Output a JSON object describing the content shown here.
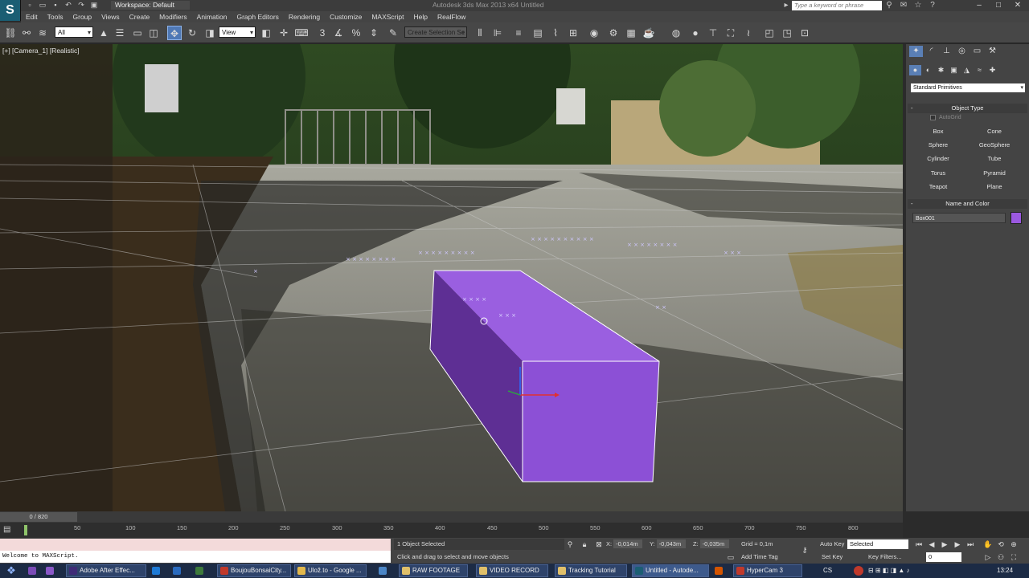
{
  "title_bar": {
    "logo": "S",
    "workspace": "Workspace: Default",
    "app_title": "Autodesk 3ds Max 2013 x64    Untitled",
    "search_placeholder": "Type a keyword or phrase"
  },
  "menu": [
    "Edit",
    "Tools",
    "Group",
    "Views",
    "Create",
    "Modifiers",
    "Animation",
    "Graph Editors",
    "Rendering",
    "Customize",
    "MAXScript",
    "Help",
    "RealFlow"
  ],
  "toolbar": {
    "selection_filter": "All",
    "ref_coord": "View",
    "named_selection": "Create Selection Se"
  },
  "viewport": {
    "label": "[+] [Camera_1] [Realistic]",
    "object_color": "#9b59e0"
  },
  "command_panel": {
    "primitive_type": "Standard Primitives",
    "object_type_header": "Object Type",
    "autogrid": "AutoGrid",
    "buttons": [
      "Box",
      "Cone",
      "Sphere",
      "GeoSphere",
      "Cylinder",
      "Tube",
      "Torus",
      "Pyramid",
      "Teapot",
      "Plane"
    ],
    "name_color_header": "Name and Color",
    "object_name": "Box001",
    "object_color": "#9b59e0"
  },
  "timeline": {
    "frame_display": "0 / 820",
    "ticks": [
      "50",
      "100",
      "150",
      "200",
      "250",
      "300",
      "350",
      "400",
      "450",
      "500",
      "550",
      "600",
      "650",
      "700",
      "750",
      "800"
    ]
  },
  "status": {
    "listener_text": "Welcome to MAXScript.",
    "selection": "1 Object Selected",
    "prompt": "Click and drag to select and move objects",
    "x_label": "X:",
    "x": "-0,014m",
    "y_label": "Y:",
    "y": "-0,043m",
    "z_label": "Z:",
    "z": "-0,035m",
    "grid": "Grid = 0,1m",
    "add_time_tag": "Add Time Tag",
    "auto_key": "Auto Key",
    "set_key": "Set Key",
    "key_mode": "Selected",
    "key_filters": "Key Filters...",
    "frame": "0"
  },
  "taskbar": {
    "items": [
      "Adobe After Effec...",
      "BoujouBonsaiCity...",
      "Ulož.to - Google ...",
      "RAW FOOTAGE",
      "VIDEO RECORD",
      "Tracking Tutorial",
      "Untitled - Autode...",
      "HyperCam 3"
    ],
    "lang": "CS",
    "time": "13:24"
  }
}
